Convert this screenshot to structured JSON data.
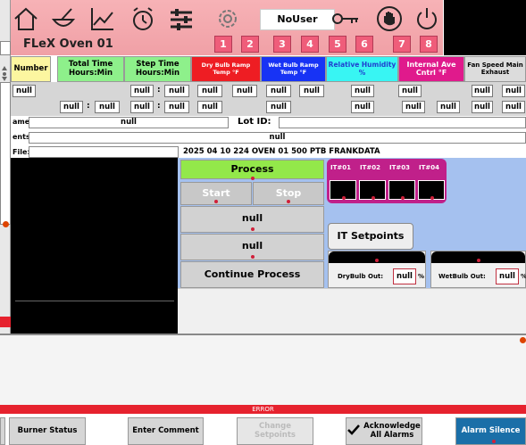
{
  "header": {
    "title": "FLeX Oven 01",
    "user": "NoUser",
    "number_buttons": [
      "1",
      "2",
      "3",
      "4",
      "5",
      "6",
      "7",
      "8"
    ]
  },
  "columns": [
    {
      "label": "Number",
      "color": "#fcf6a0"
    },
    {
      "label": "Total Time Hours:Min",
      "color": "#8ef08b"
    },
    {
      "label": "Step Time Hours:Min",
      "color": "#8ef08b"
    },
    {
      "label": "Dry Bulb Ramp Temp °F",
      "color": "#ee1d23"
    },
    {
      "label": "Wet Bulb Ramp Temp °F",
      "color": "#1733f5"
    },
    {
      "label": "Relative Humidity %",
      "color": "#38f5f3"
    },
    {
      "label": "Internal Ave Cntrl °F",
      "color": "#e01a8c"
    },
    {
      "label": "Fan Speed Main Exhaust",
      "color": "#dcdcdc"
    }
  ],
  "null_text": "null",
  "info": {
    "name_label": "ame:",
    "name_value": "null",
    "lot_label": "Lot ID:",
    "events_label": "ents:",
    "events_value": "null",
    "file_label": "File:",
    "file_value": "2025 04 10 224 OVEN 01 500 PTB FRANKDATA"
  },
  "process": {
    "process_label": "Process",
    "start_label": "Start",
    "stop_label": "Stop",
    "null1": "null",
    "null2": "null",
    "continue_label": "Continue Process",
    "it_labels": [
      "IT#01",
      "IT#02",
      "IT#03",
      "IT#04"
    ],
    "it_setpoints_label": "IT Setpoints",
    "drybulb_out_label": "DryBulb Out:",
    "drybulb_out_value": "null",
    "wetbulb_out_label": "WetBulb Out:",
    "wetbulb_out_value": "null",
    "pct": "%"
  },
  "error_text": "ERROR",
  "footer": {
    "burner_status": "Burner Status",
    "enter_comment": "Enter Comment",
    "change_setpoints": "Change Setpoints",
    "acknowledge_line1": "Acknowledge",
    "acknowledge_line2": "All Alarms",
    "alarm_silence": "Alarm Silence"
  },
  "colors": {
    "header_bg": "#f4a9ae",
    "process_green": "#93e84a",
    "it_panel": "#c0208a",
    "main_panel": "#a5c1ef",
    "error_red": "#e6222e",
    "alarm_blue": "#1a6fa8"
  }
}
